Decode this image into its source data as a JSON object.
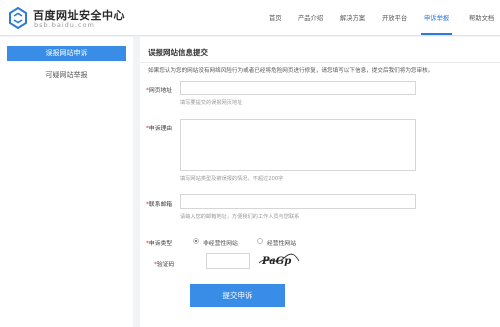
{
  "header": {
    "title": "百度网址安全中心",
    "subtitle": "bsb.baidu.com",
    "logo_icon": "baidu-security-logo-icon",
    "accent_color": "#2d7ad7"
  },
  "nav": {
    "items": [
      {
        "label": "首页"
      },
      {
        "label": "产品介绍"
      },
      {
        "label": "解决方案"
      },
      {
        "label": "开放平台"
      },
      {
        "label": "申诉举报",
        "active": true
      },
      {
        "label": "帮助文档"
      }
    ]
  },
  "sidebar": {
    "items": [
      {
        "label": "误报网站申诉",
        "active": true
      },
      {
        "label": "可疑网站举报",
        "active": false
      }
    ],
    "active_color": "#3a8de6"
  },
  "main": {
    "title": "误报网站信息提交",
    "intro": "如果您认为您的网站没有网络风险行为或者已经将危险网页进行修复，请您填写以下信息，提交后我们将为您审核。",
    "form": {
      "url": {
        "required_mark": "*",
        "label": "网页地址",
        "value": "",
        "hint": "填写要提交的误报网页地址"
      },
      "reason": {
        "required_mark": "*",
        "label": "申诉理由",
        "value": "",
        "hint": "填写网站类型及被误报的情况，不超过200字"
      },
      "email": {
        "required_mark": "*",
        "label": "联系邮箱",
        "value": "",
        "hint": "请输入您的邮箱地址，方便我们的工作人员与您联系"
      },
      "appeal_type": {
        "required_mark": "*",
        "label": "申诉类型",
        "options": [
          {
            "label": "非经营性网站",
            "checked": true
          },
          {
            "label": "经营性网站",
            "checked": false
          }
        ]
      },
      "captcha": {
        "required_mark": "*",
        "label": "验证码",
        "value": "",
        "image_text": "PaGp"
      },
      "submit_label": "提交申诉"
    }
  }
}
